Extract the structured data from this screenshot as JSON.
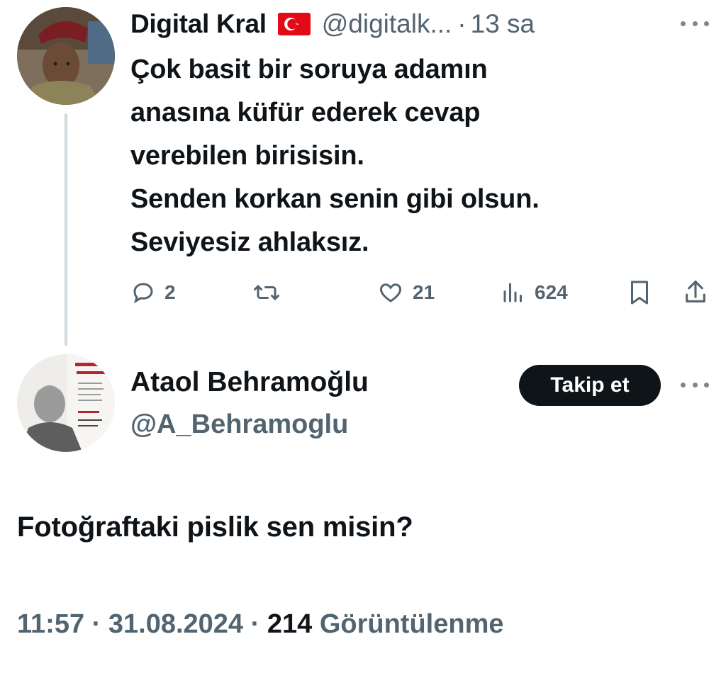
{
  "parent_tweet": {
    "display_name": "Digital Kral",
    "flag_icon": "turkey-flag-icon",
    "handle": "@digitalk...",
    "separator": "·",
    "time_ago": "13 sa",
    "text_lines": [
      "Çok basit bir soruya adamın",
      "anasına küfür ederek cevap",
      "verebilen birisisin.",
      "Senden korkan senin gibi olsun.",
      "Seviyesiz ahlaksız."
    ],
    "actions": {
      "reply_count": "2",
      "retweet_count": "",
      "like_count": "21",
      "views_count": "624"
    }
  },
  "main_tweet": {
    "display_name": "Ataol Behramoğlu",
    "handle": "@A_Behramoglu",
    "follow_label": "Takip et",
    "text": "Fotoğraftaki pislik sen misin?",
    "meta": {
      "time": "11:57",
      "separator": "·",
      "date": "31.08.2024",
      "views_count": "214",
      "views_label": "Görüntülenme"
    }
  },
  "colors": {
    "text_primary": "#0f1419",
    "text_secondary": "#536471",
    "thread_line": "#cfd9de",
    "button_bg": "#0f1419",
    "flag_red": "#e30a17"
  }
}
